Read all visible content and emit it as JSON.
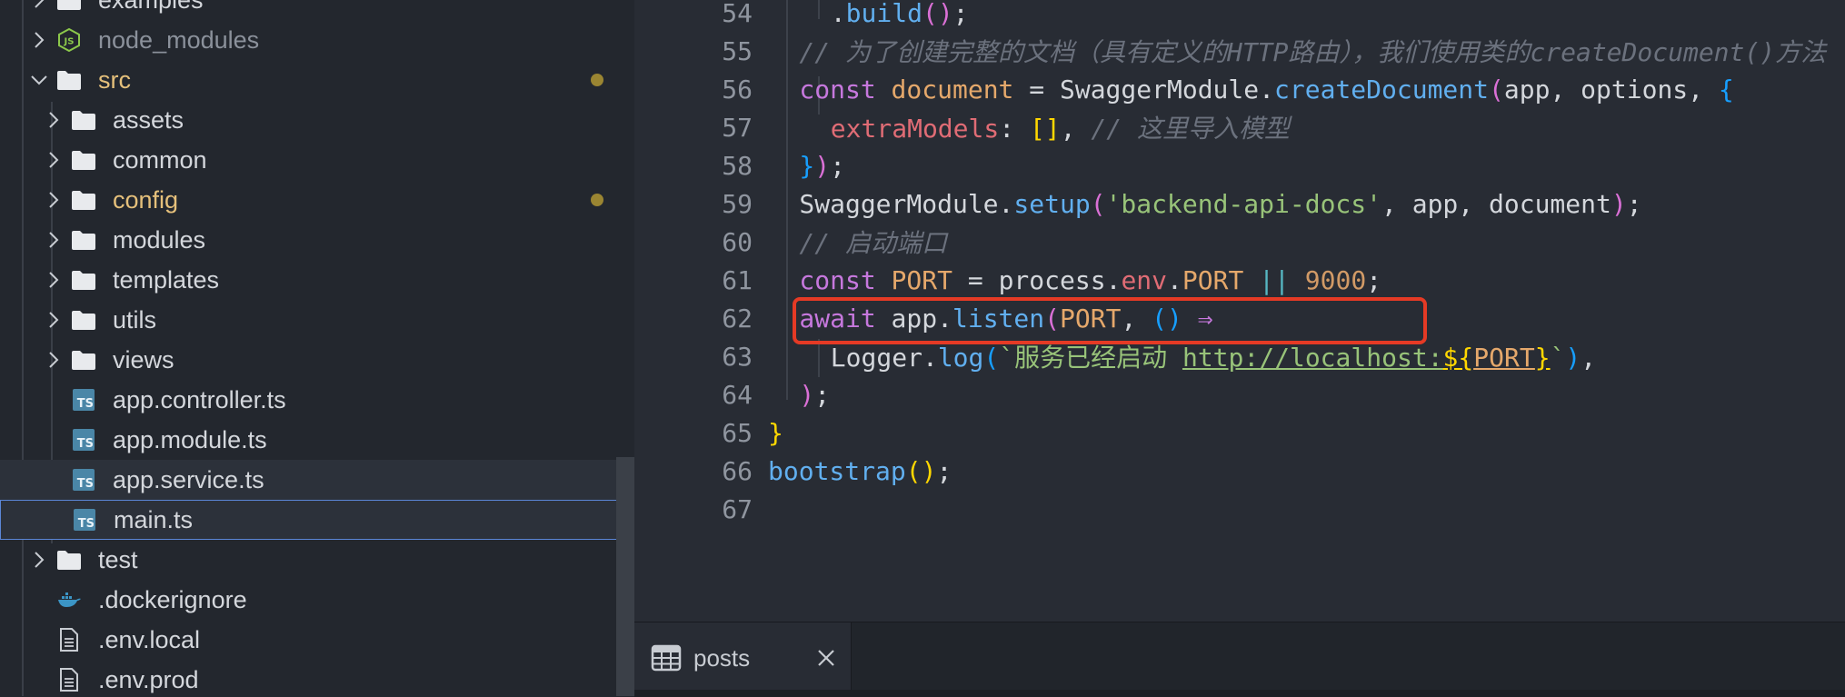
{
  "explorer": {
    "items": [
      {
        "label": "examples",
        "kind": "folder",
        "state": "collapsed",
        "depth": 0,
        "icon": "folder-icon"
      },
      {
        "label": "node_modules",
        "kind": "folder",
        "state": "collapsed",
        "depth": 0,
        "icon": "nodejs-folder-icon",
        "dimmed": true
      },
      {
        "label": "src",
        "kind": "folder",
        "state": "expanded",
        "depth": 0,
        "icon": "folder-icon",
        "modified": true
      },
      {
        "label": "assets",
        "kind": "folder",
        "state": "collapsed",
        "depth": 1,
        "icon": "folder-icon"
      },
      {
        "label": "common",
        "kind": "folder",
        "state": "collapsed",
        "depth": 1,
        "icon": "folder-icon"
      },
      {
        "label": "config",
        "kind": "folder",
        "state": "collapsed",
        "depth": 1,
        "icon": "folder-icon",
        "modified": true
      },
      {
        "label": "modules",
        "kind": "folder",
        "state": "collapsed",
        "depth": 1,
        "icon": "folder-icon"
      },
      {
        "label": "templates",
        "kind": "folder",
        "state": "collapsed",
        "depth": 1,
        "icon": "folder-icon"
      },
      {
        "label": "utils",
        "kind": "folder",
        "state": "collapsed",
        "depth": 1,
        "icon": "folder-icon"
      },
      {
        "label": "views",
        "kind": "folder",
        "state": "collapsed",
        "depth": 1,
        "icon": "folder-icon"
      },
      {
        "label": "app.controller.ts",
        "kind": "file",
        "depth": 1,
        "icon": "typescript-file-icon"
      },
      {
        "label": "app.module.ts",
        "kind": "file",
        "depth": 1,
        "icon": "typescript-file-icon"
      },
      {
        "label": "app.service.ts",
        "kind": "file",
        "depth": 1,
        "icon": "typescript-file-icon",
        "hover": true
      },
      {
        "label": "main.ts",
        "kind": "file",
        "depth": 1,
        "icon": "typescript-file-icon",
        "selected": true
      },
      {
        "label": "test",
        "kind": "folder",
        "state": "collapsed",
        "depth": 0,
        "icon": "folder-icon"
      },
      {
        "label": ".dockerignore",
        "kind": "file",
        "depth": 0,
        "icon": "docker-icon"
      },
      {
        "label": ".env.local",
        "kind": "file",
        "depth": 0,
        "icon": "document-icon"
      },
      {
        "label": ".env.prod",
        "kind": "file",
        "depth": 0,
        "icon": "document-icon"
      }
    ],
    "ts_badge": "TS"
  },
  "editor": {
    "lines": [
      {
        "num": "54",
        "indent": 2,
        "tokens": [
          {
            "t": ".",
            "c": "t"
          },
          {
            "t": "build",
            "c": "f"
          },
          {
            "t": "(",
            "c": "b2"
          },
          {
            "t": ")",
            "c": "b2"
          },
          {
            "t": ";",
            "c": "t"
          }
        ]
      },
      {
        "num": "55",
        "indent": 1,
        "tokens": [
          {
            "t": "// 为了创建完整的文档（具有定义的HTTP路由），我们使用类的createDocument()方法",
            "c": "c"
          }
        ]
      },
      {
        "num": "56",
        "indent": 1,
        "tokens": [
          {
            "t": "const ",
            "c": "k"
          },
          {
            "t": "document",
            "c": "v"
          },
          {
            "t": " = ",
            "c": "t"
          },
          {
            "t": "SwaggerModule",
            "c": "t"
          },
          {
            "t": ".",
            "c": "t"
          },
          {
            "t": "createDocument",
            "c": "f"
          },
          {
            "t": "(",
            "c": "b2"
          },
          {
            "t": "app, options, ",
            "c": "t"
          },
          {
            "t": "{",
            "c": "b3"
          }
        ]
      },
      {
        "num": "57",
        "indent": 2,
        "tokens": [
          {
            "t": "extraModels",
            "c": "p"
          },
          {
            "t": ": ",
            "c": "t"
          },
          {
            "t": "[]",
            "c": "b1"
          },
          {
            "t": ", ",
            "c": "t"
          },
          {
            "t": "// 这里导入模型",
            "c": "c"
          }
        ]
      },
      {
        "num": "58",
        "indent": 1,
        "tokens": [
          {
            "t": "}",
            "c": "b3"
          },
          {
            "t": ")",
            "c": "b2"
          },
          {
            "t": ";",
            "c": "t"
          }
        ]
      },
      {
        "num": "59",
        "indent": 1,
        "tokens": [
          {
            "t": "SwaggerModule",
            "c": "t"
          },
          {
            "t": ".",
            "c": "t"
          },
          {
            "t": "setup",
            "c": "f"
          },
          {
            "t": "(",
            "c": "b2"
          },
          {
            "t": "'backend-api-docs'",
            "c": "s"
          },
          {
            "t": ", app, document",
            "c": "t"
          },
          {
            "t": ")",
            "c": "b2"
          },
          {
            "t": ";",
            "c": "t"
          }
        ]
      },
      {
        "num": "60",
        "indent": 1,
        "tokens": [
          {
            "t": "// 启动端口",
            "c": "c"
          }
        ]
      },
      {
        "num": "61",
        "indent": 1,
        "tokens": [
          {
            "t": "const ",
            "c": "k"
          },
          {
            "t": "PORT",
            "c": "v"
          },
          {
            "t": " = ",
            "c": "t"
          },
          {
            "t": "process",
            "c": "t"
          },
          {
            "t": ".",
            "c": "t"
          },
          {
            "t": "env",
            "c": "p"
          },
          {
            "t": ".",
            "c": "t"
          },
          {
            "t": "PORT",
            "c": "v"
          },
          {
            "t": " || ",
            "c": "o"
          },
          {
            "t": "9000",
            "c": "n"
          },
          {
            "t": ";",
            "c": "t"
          }
        ]
      },
      {
        "num": "62",
        "indent": 1,
        "tokens": [
          {
            "t": "await ",
            "c": "k"
          },
          {
            "t": "app",
            "c": "t"
          },
          {
            "t": ".",
            "c": "t"
          },
          {
            "t": "listen",
            "c": "f"
          },
          {
            "t": "(",
            "c": "b2"
          },
          {
            "t": "PORT",
            "c": "v"
          },
          {
            "t": ", ",
            "c": "t"
          },
          {
            "t": "()",
            "c": "b3"
          },
          {
            "t": " ⇒",
            "c": "k"
          }
        ]
      },
      {
        "num": "63",
        "indent": 2,
        "tokens": [
          {
            "t": "Logger",
            "c": "t"
          },
          {
            "t": ".",
            "c": "t"
          },
          {
            "t": "log",
            "c": "f"
          },
          {
            "t": "(",
            "c": "b3"
          },
          {
            "t": "`服务已经启动 ",
            "c": "s"
          },
          {
            "t": "http://localhost:",
            "c": "s u"
          },
          {
            "t": "${",
            "c": "b1 u"
          },
          {
            "t": "PORT",
            "c": "v u"
          },
          {
            "t": "}",
            "c": "b1 u"
          },
          {
            "t": "`",
            "c": "s"
          },
          {
            "t": ")",
            "c": "b3"
          },
          {
            "t": ",",
            "c": "t"
          }
        ]
      },
      {
        "num": "64",
        "indent": 1,
        "tokens": [
          {
            "t": ")",
            "c": "b2"
          },
          {
            "t": ";",
            "c": "t"
          }
        ]
      },
      {
        "num": "65",
        "indent": 0,
        "tokens": [
          {
            "t": "}",
            "c": "b1"
          }
        ]
      },
      {
        "num": "66",
        "indent": 0,
        "tokens": [
          {
            "t": "bootstrap",
            "c": "f"
          },
          {
            "t": "(",
            "c": "b1"
          },
          {
            "t": ")",
            "c": "b1"
          },
          {
            "t": ";",
            "c": "t"
          }
        ]
      },
      {
        "num": "67",
        "indent": 0,
        "tokens": []
      }
    ]
  },
  "panel": {
    "tab_label": "posts",
    "tab_icon": "table-icon",
    "close_icon": "close-icon"
  },
  "colors": {
    "highlight_box": "#e53a25",
    "modified_text": "#e5c07b",
    "modified_dot": "#9a8532",
    "selection_border": "#5b86d6"
  }
}
